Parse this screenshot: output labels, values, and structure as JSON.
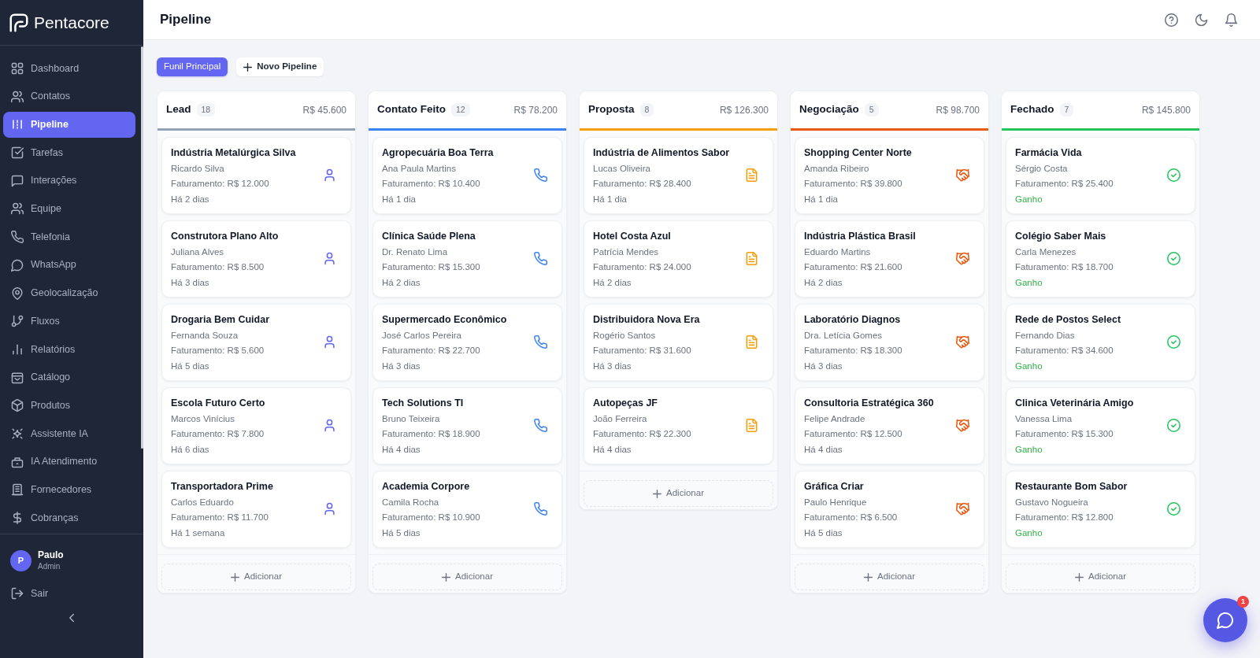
{
  "sidebar": {
    "brand": "Pentacore",
    "items": [
      {
        "label": "Dashboard",
        "selected": false
      },
      {
        "label": "Contatos",
        "selected": false
      },
      {
        "label": "Pipeline",
        "selected": true
      },
      {
        "label": "Tarefas",
        "selected": false
      },
      {
        "label": "Interações",
        "selected": false
      },
      {
        "label": "Equipe",
        "selected": false
      },
      {
        "label": "Telefonia",
        "selected": false
      },
      {
        "label": "WhatsApp",
        "selected": false
      },
      {
        "label": "Geolocalização",
        "selected": false
      },
      {
        "label": "Fluxos",
        "selected": false
      },
      {
        "label": "Relatórios",
        "selected": false
      },
      {
        "label": "Catálogo",
        "selected": false
      },
      {
        "label": "Produtos",
        "selected": false
      },
      {
        "label": "Assistente IA",
        "selected": false
      },
      {
        "label": "IA Atendimento",
        "selected": false
      },
      {
        "label": "Fornecedores",
        "selected": false
      },
      {
        "label": "Cobranças",
        "selected": false
      }
    ],
    "user": {
      "initial": "P",
      "name": "Paulo",
      "role": "Admin"
    },
    "logout": "Sair"
  },
  "header": {
    "title": "Pipeline"
  },
  "pipeline_tabs": [
    {
      "label": "Funil Principal",
      "selected": true
    }
  ],
  "new_pipeline_button": "Novo Pipeline",
  "columns": [
    {
      "title": "Lead",
      "count": "18",
      "total": "R$ 45.600",
      "color": "#94a3b8",
      "kind": "lead",
      "cards": [
        {
          "company": "Indústria Metalúrgica Silva",
          "contact": "Ricardo Silva",
          "revenue": "Faturamento: R$ 12.000",
          "age": "Há 2 dias"
        },
        {
          "company": "Construtora Plano Alto",
          "contact": "Juliana Alves",
          "revenue": "Faturamento: R$ 8.500",
          "age": "Há 3 dias"
        },
        {
          "company": "Drogaria Bem Cuidar",
          "contact": "Fernanda Souza",
          "revenue": "Faturamento: R$ 5.600",
          "age": "Há 5 dias"
        },
        {
          "company": "Escola Futuro Certo",
          "contact": "Marcos Vinícius",
          "revenue": "Faturamento: R$ 7.800",
          "age": "Há 6 dias"
        },
        {
          "company": "Transportadora Prime",
          "contact": "Carlos Eduardo",
          "revenue": "Faturamento: R$ 11.700",
          "age": "Há 1 semana"
        }
      ],
      "add_button": "Adicionar"
    },
    {
      "title": "Contato Feito",
      "count": "12",
      "total": "R$ 78.200",
      "color": "#3b82f6",
      "kind": "contact",
      "cards": [
        {
          "company": "Agropecuária Boa Terra",
          "contact": "Ana Paula Martins",
          "revenue": "Faturamento: R$ 10.400",
          "age": "Há 1 dia"
        },
        {
          "company": "Clínica Saúde Plena",
          "contact": "Dr. Renato Lima",
          "revenue": "Faturamento: R$ 15.300",
          "age": "Há 2 dias"
        },
        {
          "company": "Supermercado Econômico",
          "contact": "José Carlos Pereira",
          "revenue": "Faturamento: R$ 22.700",
          "age": "Há 3 dias"
        },
        {
          "company": "Tech Solutions TI",
          "contact": "Bruno Teixeira",
          "revenue": "Faturamento: R$ 18.900",
          "age": "Há 4 dias"
        },
        {
          "company": "Academia Corpore",
          "contact": "Camila Rocha",
          "revenue": "Faturamento: R$ 10.900",
          "age": "Há 5 dias"
        }
      ],
      "add_button": "Adicionar"
    },
    {
      "title": "Proposta",
      "count": "8",
      "total": "R$ 126.300",
      "color": "#f59e0b",
      "kind": "proposal",
      "cards": [
        {
          "company": "Indústria de Alimentos Sabor",
          "contact": "Lucas Oliveira",
          "revenue": "Faturamento: R$ 28.400",
          "age": "Há 1 dia"
        },
        {
          "company": "Hotel Costa Azul",
          "contact": "Patrícia Mendes",
          "revenue": "Faturamento: R$ 24.000",
          "age": "Há 2 dias"
        },
        {
          "company": "Distribuidora Nova Era",
          "contact": "Rogério Santos",
          "revenue": "Faturamento: R$ 31.600",
          "age": "Há 3 dias"
        },
        {
          "company": "Autopeças JF",
          "contact": "João Ferreira",
          "revenue": "Faturamento: R$ 22.300",
          "age": "Há 4 dias"
        }
      ],
      "add_button": "Adicionar"
    },
    {
      "title": "Negociação",
      "count": "5",
      "total": "R$ 98.700",
      "color": "#ea580c",
      "kind": "negotiation",
      "cards": [
        {
          "company": "Shopping Center Norte",
          "contact": "Amanda Ribeiro",
          "revenue": "Faturamento: R$ 39.800",
          "age": "Há 1 dia"
        },
        {
          "company": "Indústria Plástica Brasil",
          "contact": "Eduardo Martins",
          "revenue": "Faturamento: R$ 21.600",
          "age": "Há 2 dias"
        },
        {
          "company": "Laboratório Diagnos",
          "contact": "Dra. Letícia Gomes",
          "revenue": "Faturamento: R$ 18.300",
          "age": "Há 3 dias"
        },
        {
          "company": "Consultoria Estratégica 360",
          "contact": "Felipe Andrade",
          "revenue": "Faturamento: R$ 12.500",
          "age": "Há 4 dias"
        },
        {
          "company": "Gráfica Criar",
          "contact": "Paulo Henrique",
          "revenue": "Faturamento: R$ 6.500",
          "age": "Há 5 dias"
        }
      ],
      "add_button": "Adicionar"
    },
    {
      "title": "Fechado",
      "count": "7",
      "total": "R$ 145.800",
      "color": "#22c55e",
      "kind": "won",
      "cards": [
        {
          "company": "Farmácia Vida",
          "contact": "Sérgio Costa",
          "revenue": "Faturamento: R$ 25.400",
          "outcome": "Ganho"
        },
        {
          "company": "Colégio Saber Mais",
          "contact": "Carla Menezes",
          "revenue": "Faturamento: R$ 18.700",
          "outcome": "Ganho"
        },
        {
          "company": "Rede de Postos Select",
          "contact": "Fernando Dias",
          "revenue": "Faturamento: R$ 34.600",
          "outcome": "Ganho"
        },
        {
          "company": "Clinica Veterinária Amigo",
          "contact": "Vanessa Lima",
          "revenue": "Faturamento: R$ 15.300",
          "outcome": "Ganho"
        },
        {
          "company": "Restaurante Bom Sabor",
          "contact": "Gustavo Nogueira",
          "revenue": "Faturamento: R$ 12.800",
          "outcome": "Ganho"
        }
      ],
      "add_button": "Adicionar"
    }
  ],
  "chat_button": {
    "badge": "1"
  }
}
